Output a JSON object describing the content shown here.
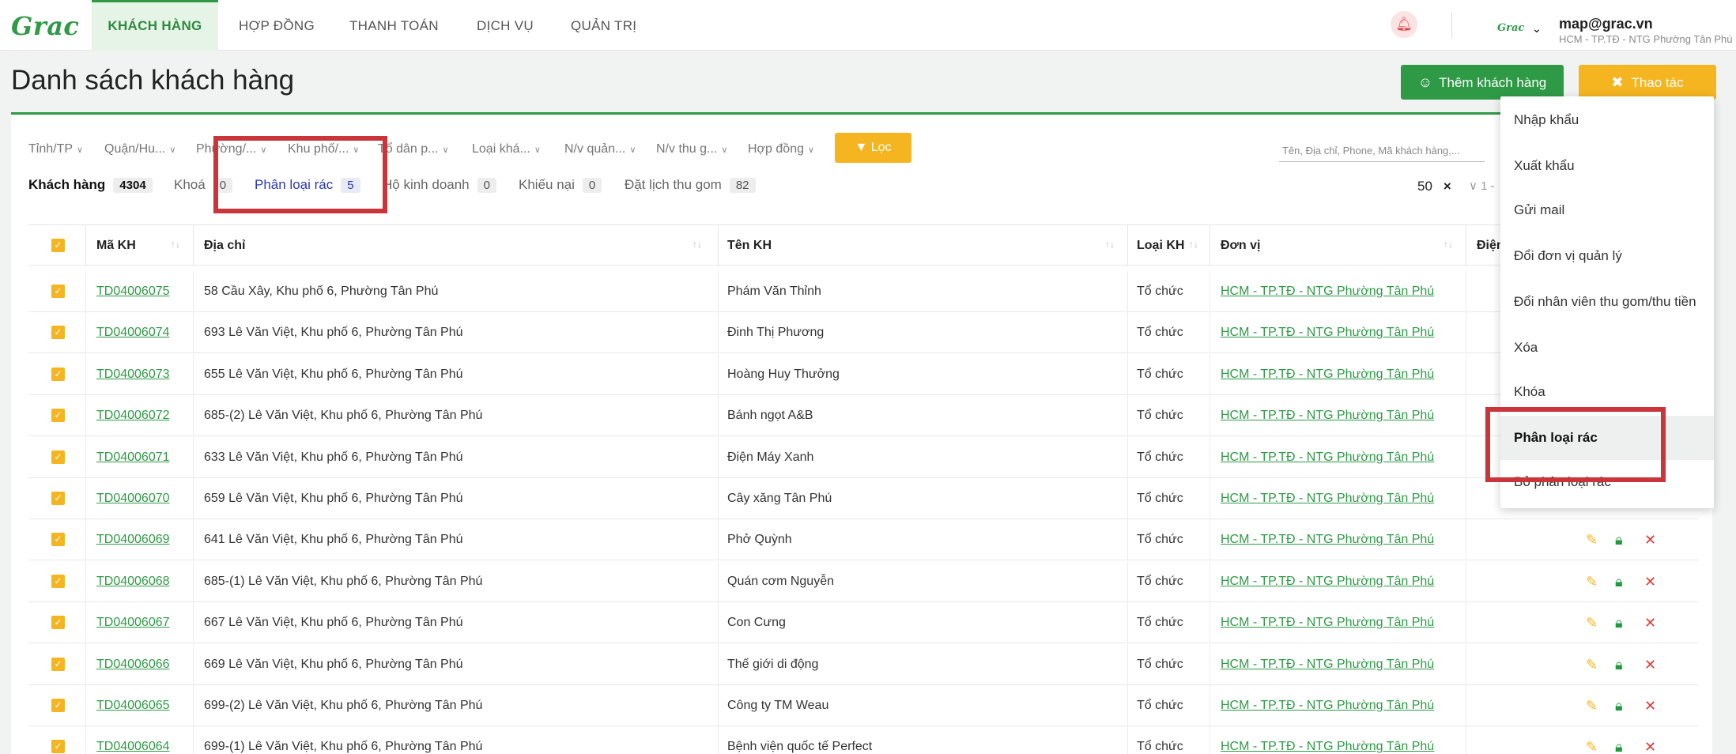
{
  "nav": {
    "logo": "Grac",
    "items": [
      "KHÁCH HÀNG",
      "HỢP ĐỒNG",
      "THANH TOÁN",
      "DỊCH VỤ",
      "QUẢN TRỊ"
    ],
    "user_logo": "Grac",
    "user_email": "map@grac.vn",
    "user_unit": "HCM - TP.TĐ - NTG Phường Tân Phú"
  },
  "page": {
    "title": "Danh sách khách hàng",
    "add_button": "Thêm khách hàng",
    "action_button": "Thao tác"
  },
  "filters": {
    "items": [
      "Tỉnh/TP",
      "Quận/Hu...",
      "Phường/...",
      "Khu phố/...",
      "Tổ dân p...",
      "Loại khá...",
      "N/v quản...",
      "N/v thu g...",
      "Hợp đồng"
    ],
    "filter_button": "Lọc",
    "search_placeholder": "Tên, Địa chỉ, Phone, Mã khách hàng,..."
  },
  "tabs": [
    {
      "label": "Khách hàng",
      "count": "4304"
    },
    {
      "label": "Khoá",
      "count": "0"
    },
    {
      "label": "Phân loại rác",
      "count": "5"
    },
    {
      "label": "Hộ kinh doanh",
      "count": "0"
    },
    {
      "label": "Khiếu nại",
      "count": "0"
    },
    {
      "label": "Đặt lịch thu gom",
      "count": "82"
    }
  ],
  "pagination": {
    "page_size": "50",
    "clear": "×",
    "range": "1 -"
  },
  "table": {
    "headers": [
      "Mã KH",
      "Địa chỉ",
      "Tên KH",
      "Loại KH",
      "Đơn vị",
      "Điện"
    ],
    "rows": [
      {
        "code": "TD04006075",
        "address": "58 Cầu Xây, Khu phố 6, Phường Tân Phú",
        "name": "Phám Văn Thỉnh",
        "type": "Tổ chức",
        "unit": "HCM - TP.TĐ - NTG Phường Tân Phú"
      },
      {
        "code": "TD04006074",
        "address": "693 Lê Văn Việt, Khu phố 6, Phường Tân Phú",
        "name": "Đinh Thị Phương",
        "type": "Tổ chức",
        "unit": "HCM - TP.TĐ - NTG Phường Tân Phú"
      },
      {
        "code": "TD04006073",
        "address": "655 Lê Văn Việt, Khu phố 6, Phường Tân Phú",
        "name": "Hoàng Huy Thưởng",
        "type": "Tổ chức",
        "unit": "HCM - TP.TĐ - NTG Phường Tân Phú"
      },
      {
        "code": "TD04006072",
        "address": "685-(2) Lê Văn Việt, Khu phố 6, Phường Tân Phú",
        "name": "Bánh ngọt A&B",
        "type": "Tổ chức",
        "unit": "HCM - TP.TĐ - NTG Phường Tân Phú"
      },
      {
        "code": "TD04006071",
        "address": "633 Lê Văn Việt, Khu phố 6, Phường Tân Phú",
        "name": "Điện Máy Xanh",
        "type": "Tổ chức",
        "unit": "HCM - TP.TĐ - NTG Phường Tân Phú"
      },
      {
        "code": "TD04006070",
        "address": "659 Lê Văn Việt, Khu phố 6, Phường Tân Phú",
        "name": "Cây xăng Tân Phú",
        "type": "Tổ chức",
        "unit": "HCM - TP.TĐ - NTG Phường Tân Phú"
      },
      {
        "code": "TD04006069",
        "address": "641 Lê Văn Việt, Khu phố 6, Phường Tân Phú",
        "name": "Phở Quỳnh",
        "type": "Tổ chức",
        "unit": "HCM - TP.TĐ - NTG Phường Tân Phú"
      },
      {
        "code": "TD04006068",
        "address": "685-(1) Lê Văn Việt, Khu phố 6, Phường Tân Phú",
        "name": "Quán cơm Nguyễn",
        "type": "Tổ chức",
        "unit": "HCM - TP.TĐ - NTG Phường Tân Phú"
      },
      {
        "code": "TD04006067",
        "address": "667 Lê Văn Việt, Khu phố 6, Phường Tân Phú",
        "name": "Con Cưng",
        "type": "Tổ chức",
        "unit": "HCM - TP.TĐ - NTG Phường Tân Phú"
      },
      {
        "code": "TD04006066",
        "address": "669 Lê Văn Việt, Khu phố 6, Phường Tân Phú",
        "name": "Thế giới di động",
        "type": "Tổ chức",
        "unit": "HCM - TP.TĐ - NTG Phường Tân Phú"
      },
      {
        "code": "TD04006065",
        "address": "699-(2) Lê Văn Việt, Khu phố 6, Phường Tân Phú",
        "name": "Công ty TM Weau",
        "type": "Tổ chức",
        "unit": "HCM - TP.TĐ - NTG Phường Tân Phú"
      },
      {
        "code": "TD04006064",
        "address": "699-(1) Lê Văn Việt, Khu phố 6, Phường Tân Phú",
        "name": "Bệnh viện quốc tế Perfect",
        "type": "Tổ chức",
        "unit": "HCM - TP.TĐ - NTG Phường Tân Phú"
      }
    ]
  },
  "menu": {
    "items": [
      "Nhập khẩu",
      "Xuất khẩu",
      "Gửi mail",
      "Đổi đơn vị quản lý",
      "Đổi nhân viên thu gom/thu tiền",
      "Xóa",
      "Khóa",
      "Phân loại rác",
      "Bỏ phân loại rác"
    ]
  },
  "colors": {
    "brand_green": "#2e9a46",
    "accent_yellow": "#f4b521",
    "annotation_red": "#c9353a",
    "link_blue": "#2a3bb3"
  }
}
